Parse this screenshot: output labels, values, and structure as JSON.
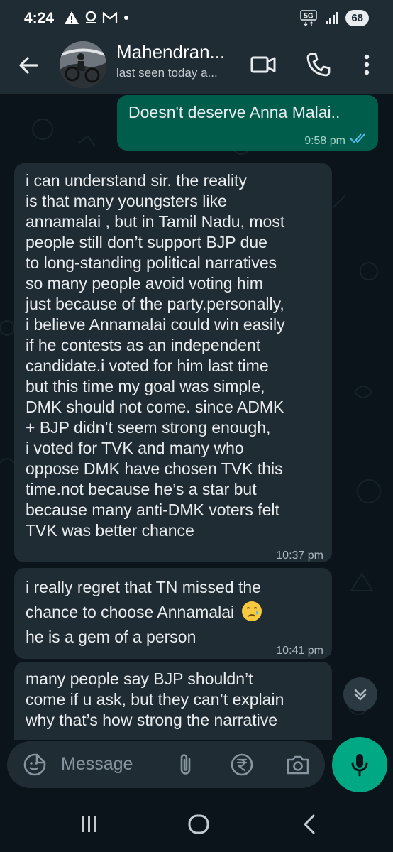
{
  "status": {
    "time": "4:24",
    "network": "5G",
    "battery": "68"
  },
  "header": {
    "contact_name": "Mahendran...",
    "last_seen": "last seen today a..."
  },
  "messages": [
    {
      "direction": "outgoing",
      "text": "Doesn't deserve Anna Malai..",
      "time": "9:58 pm",
      "status": "read"
    },
    {
      "direction": "incoming",
      "lines": [
        "i can understand sir. the reality",
        "is that many youngsters like",
        "annamalai , but in Tamil Nadu, most",
        "people still don’t support BJP due",
        "to long-standing political narratives",
        "so many people avoid voting him",
        "just because of the party.personally,",
        "i believe Annamalai could win easily",
        "if he contests as an independent",
        "candidate.i voted for him last time",
        "but this time my goal was simple,",
        "DMK should not come. since ADMK",
        "+ BJP didn’t seem strong enough,",
        "i voted for TVK and many who",
        "oppose DMK have chosen TVK this",
        "time.not because he’s a star but",
        "because many anti-DMK voters felt",
        "TVK was better chance"
      ],
      "time": "10:37 pm"
    },
    {
      "direction": "incoming",
      "lines": [
        "i really regret that TN missed the",
        "chance to choose Annamalai",
        "he is a gem of a person"
      ],
      "emoji": "😢",
      "time": "10:41 pm"
    },
    {
      "direction": "incoming",
      "lines": [
        "many people say BJP shouldn’t",
        "come if u ask, but they can’t explain",
        "why that’s how strong the narrative"
      ]
    }
  ],
  "input": {
    "placeholder": "Message"
  },
  "colors": {
    "outgoing_bubble": "#005c4b",
    "incoming_bubble": "#202c33",
    "accent": "#00a884",
    "read_ticks": "#53bdeb"
  },
  "icons": [
    "back-arrow-icon",
    "video-call-icon",
    "voice-call-icon",
    "more-options-icon",
    "emoji-sticker-icon",
    "attach-icon",
    "rupee-payment-icon",
    "camera-icon",
    "mic-icon",
    "scroll-down-icon",
    "recents-nav-icon",
    "home-nav-icon",
    "back-nav-icon"
  ]
}
